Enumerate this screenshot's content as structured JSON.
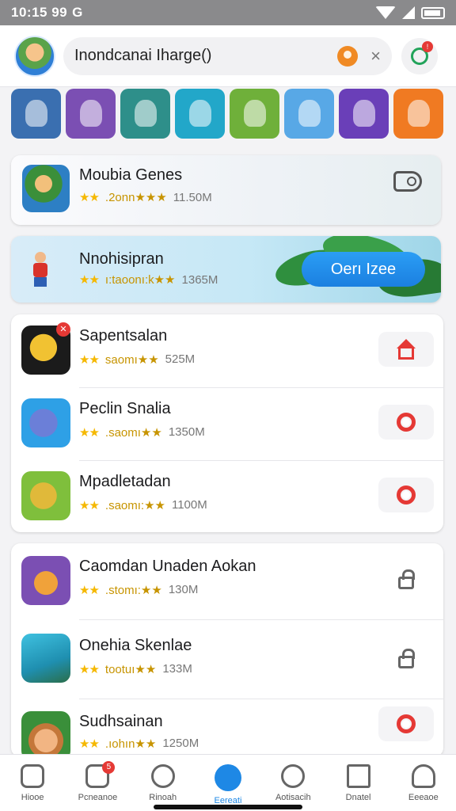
{
  "status": {
    "time": "10:15 99",
    "carrier_glyph": "G"
  },
  "header": {
    "search_text": "Inondcanai Iharge()",
    "clear_glyph": "×",
    "notif_count": "!"
  },
  "categories": [
    {
      "icon": "category-icon",
      "color": "#3a6fb0"
    },
    {
      "icon": "category-icon",
      "color": "#7b4fb3"
    },
    {
      "icon": "category-icon",
      "color": "#2e8f8a"
    },
    {
      "icon": "category-icon",
      "color": "#22a7c9"
    },
    {
      "icon": "category-icon",
      "color": "#6fb03a"
    },
    {
      "icon": "category-icon",
      "color": "#58a8e6"
    },
    {
      "icon": "category-icon",
      "color": "#6a3fb8"
    },
    {
      "icon": "category-icon",
      "color": "#f07a22"
    }
  ],
  "featured": [
    {
      "title": "Moubia Genes",
      "stars": "★★",
      "rating_text": ".2onn★★★",
      "size": "11.50M"
    },
    {
      "title": "Nnohisipran",
      "stars": "★★",
      "rating_text": "ı:taoonı:k★★",
      "size": "1365M",
      "cta": "Oerı Izee"
    }
  ],
  "list1": [
    {
      "name": "Sapentsalan",
      "stars": "★★",
      "rating_text": "saomı★★",
      "size": "525M",
      "badge": "✕",
      "action_icon": "house-icon"
    },
    {
      "name": "Peclin Snalia",
      "stars": "★★",
      "rating_text": ".saomı★★",
      "size": "1350M",
      "badge": "",
      "action_icon": "gear-icon"
    },
    {
      "name": "Mpadletadan",
      "stars": "★★",
      "rating_text": ".saomı:★★",
      "size": "1100M",
      "badge": "",
      "action_icon": "gear-icon"
    }
  ],
  "list2": [
    {
      "name": "Caomdan Unaden Aokan",
      "stars": "★★",
      "rating_text": ".stomı:★★",
      "size": "130M",
      "action_icon": "lock-icon"
    },
    {
      "name": "Onehia Skenlae",
      "stars": "★★",
      "rating_text": "tootuı★★",
      "size": "133M",
      "action_icon": "lock-icon"
    },
    {
      "name": "Sudhsainan",
      "stars": "★★",
      "rating_text": ".ıohın★★",
      "size": "1250M",
      "action_icon": "gear-icon"
    }
  ],
  "nav": [
    {
      "label": "Hiooe",
      "icon": "home-icon",
      "active": false,
      "badge": ""
    },
    {
      "label": "Pcneanoe",
      "icon": "games-icon",
      "active": false,
      "badge": "5"
    },
    {
      "label": "Rinoah",
      "icon": "chat-icon",
      "active": false,
      "badge": ""
    },
    {
      "label": "Eereati",
      "icon": "discover-icon",
      "active": true,
      "badge": ""
    },
    {
      "label": "Aotisacih",
      "icon": "search-icon",
      "active": false,
      "badge": ""
    },
    {
      "label": "Dnatel",
      "icon": "grid-icon",
      "active": false,
      "badge": ""
    },
    {
      "label": "Eeeaoe",
      "icon": "profile-icon",
      "active": false,
      "badge": ""
    }
  ],
  "colors": {
    "accent": "#1e88e5",
    "danger": "#e53935",
    "star": "#f5b800"
  }
}
